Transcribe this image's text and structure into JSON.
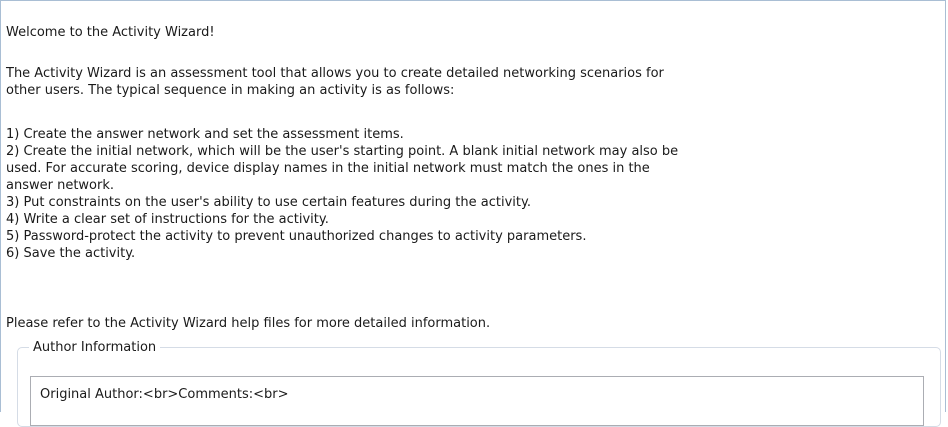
{
  "wizard": {
    "welcome": "Welcome to the Activity Wizard!",
    "intro": "The Activity Wizard is an assessment tool that allows you to create detailed networking scenarios for\nother users. The typical sequence in making an activity is as follows:",
    "steps": [
      "1) Create the answer network and set the assessment items.",
      "2) Create the initial network, which will be the user's starting point. A blank initial network may also be\nused. For accurate scoring, device display names in the initial network must match the ones in the\nanswer network.",
      "3) Put constraints on the user's ability to use certain features during the activity.",
      "4) Write a clear set of instructions for the activity.",
      "5) Password-protect the activity to prevent unauthorized changes to activity parameters.",
      "6) Save the activity."
    ],
    "footer": "Please refer to the Activity Wizard help files for more detailed information."
  },
  "author_info": {
    "legend": "Author Information",
    "field_value": "Original Author:<br>Comments:<br>"
  }
}
